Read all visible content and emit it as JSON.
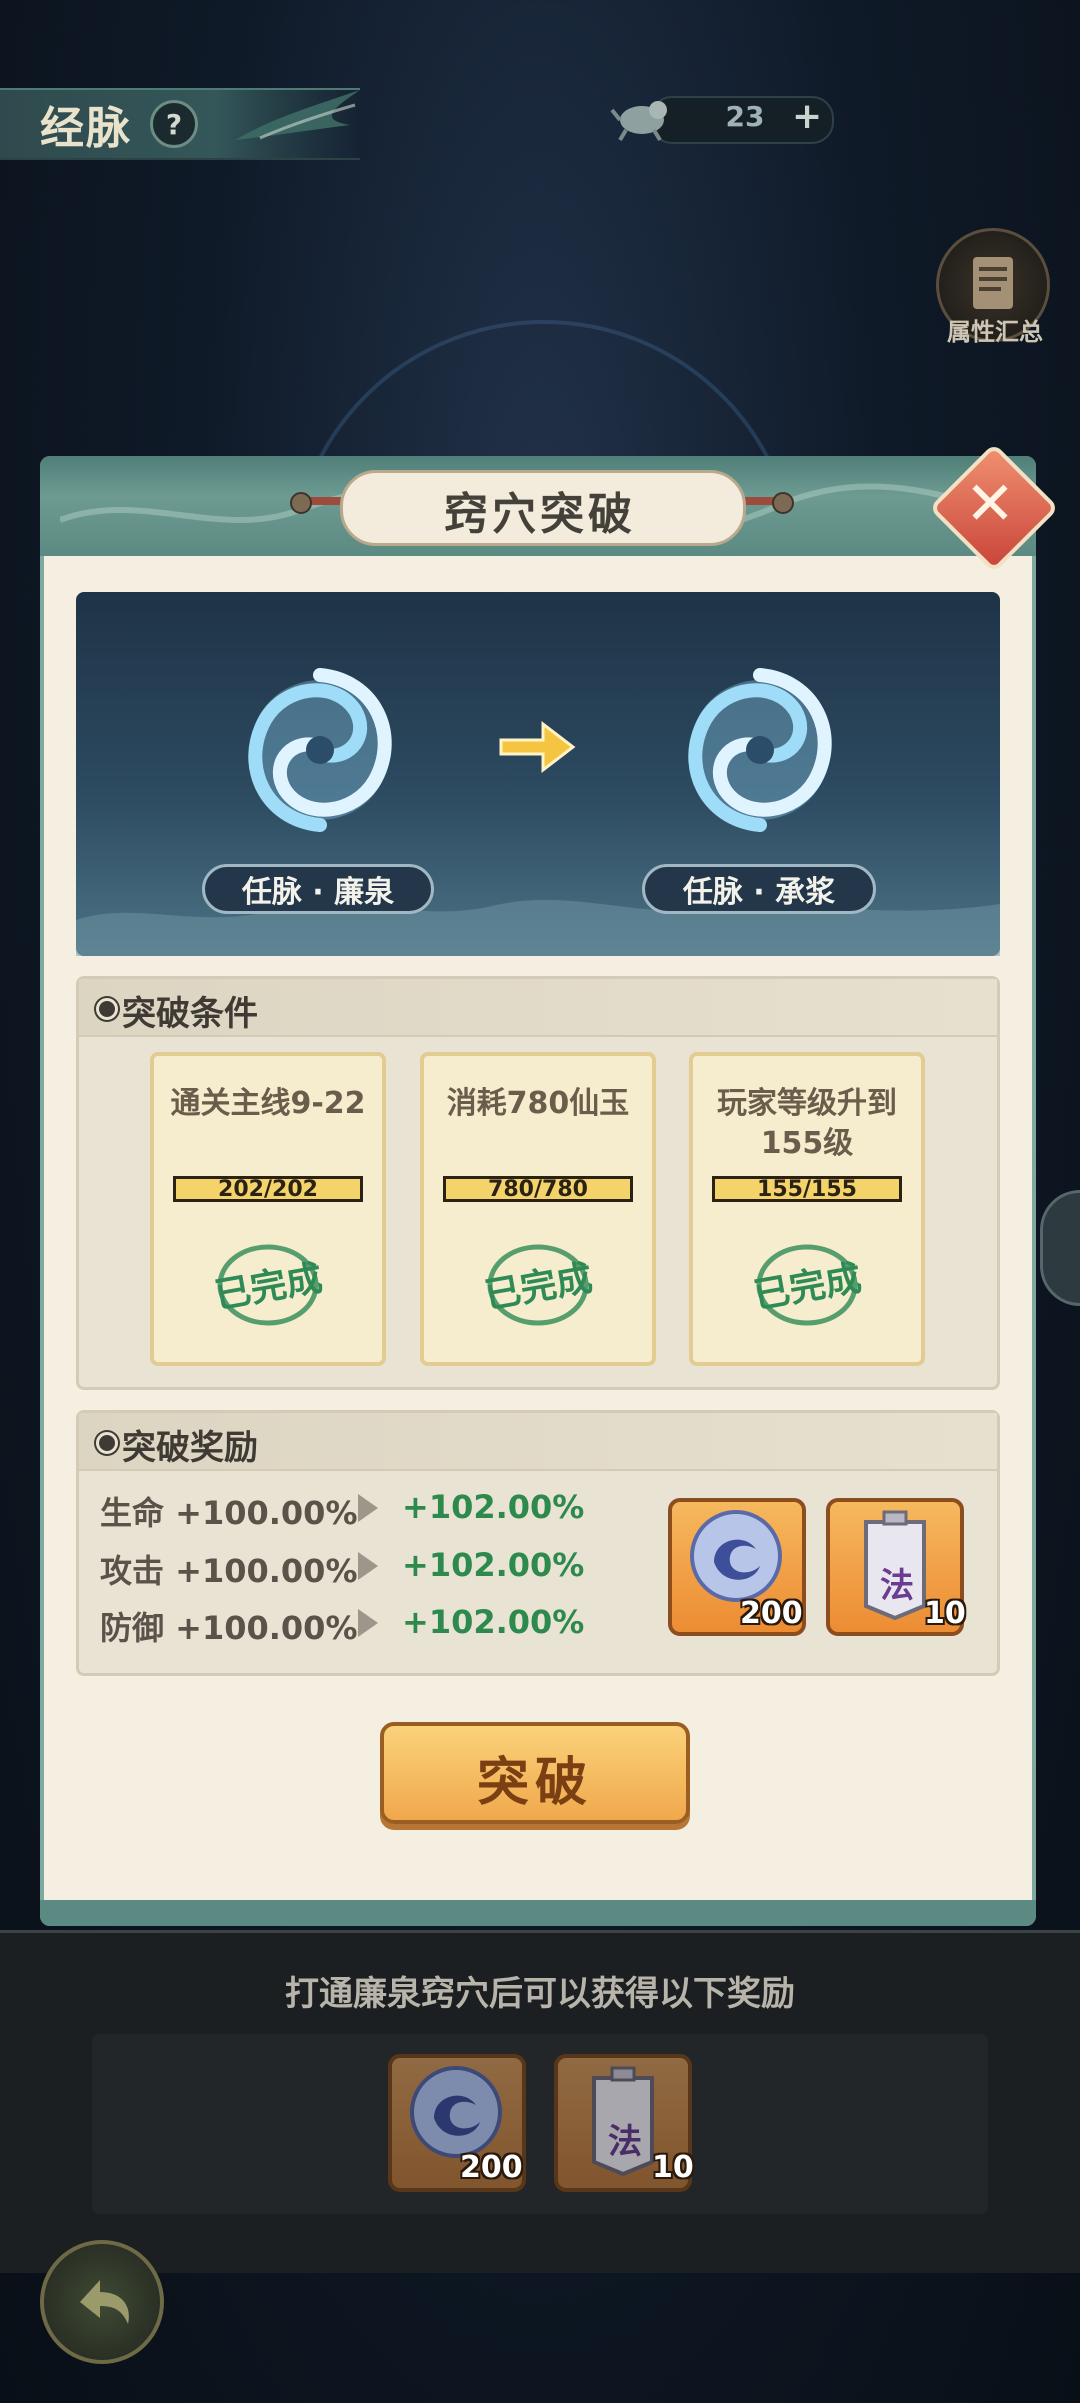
{
  "hud": {
    "page_title": "经脉",
    "help_icon": "?",
    "currency_value": "23",
    "currency_plus": "+",
    "attr_summary_label": "属性汇总"
  },
  "dialog": {
    "title": "窍穴突破",
    "close_icon": "✕",
    "from_node": "任脉 · 廉泉",
    "to_node": "任脉 · 承浆",
    "conditions_title": "突破条件",
    "conditions": [
      {
        "text": "通关主线9-22",
        "progress": "202/202",
        "status": "已完成"
      },
      {
        "text": "消耗780仙玉",
        "progress": "780/780",
        "status": "已完成"
      },
      {
        "text": "玩家等级升到155级",
        "progress": "155/155",
        "status": "已完成"
      }
    ],
    "rewards_title": "突破奖励",
    "stats": [
      {
        "label": "生命 +100.00%",
        "new": "+102.00%"
      },
      {
        "label": "攻击 +100.00%",
        "new": "+102.00%"
      },
      {
        "label": "防御 +100.00%",
        "new": "+102.00%"
      }
    ],
    "items": [
      {
        "icon": "jade-swirl-icon",
        "count": "200"
      },
      {
        "icon": "talisman-icon",
        "char": "法",
        "count": "10"
      }
    ],
    "break_button": "突破"
  },
  "bottom": {
    "hint": "打通廉泉窍穴后可以获得以下奖励",
    "items": [
      {
        "icon": "jade-swirl-icon",
        "count": "200"
      },
      {
        "icon": "talisman-icon",
        "char": "法",
        "count": "10"
      }
    ]
  },
  "colors": {
    "accent_green": "#2e8a4c",
    "header_teal": "#5b8a82",
    "button_orange": "#f0a84c"
  }
}
